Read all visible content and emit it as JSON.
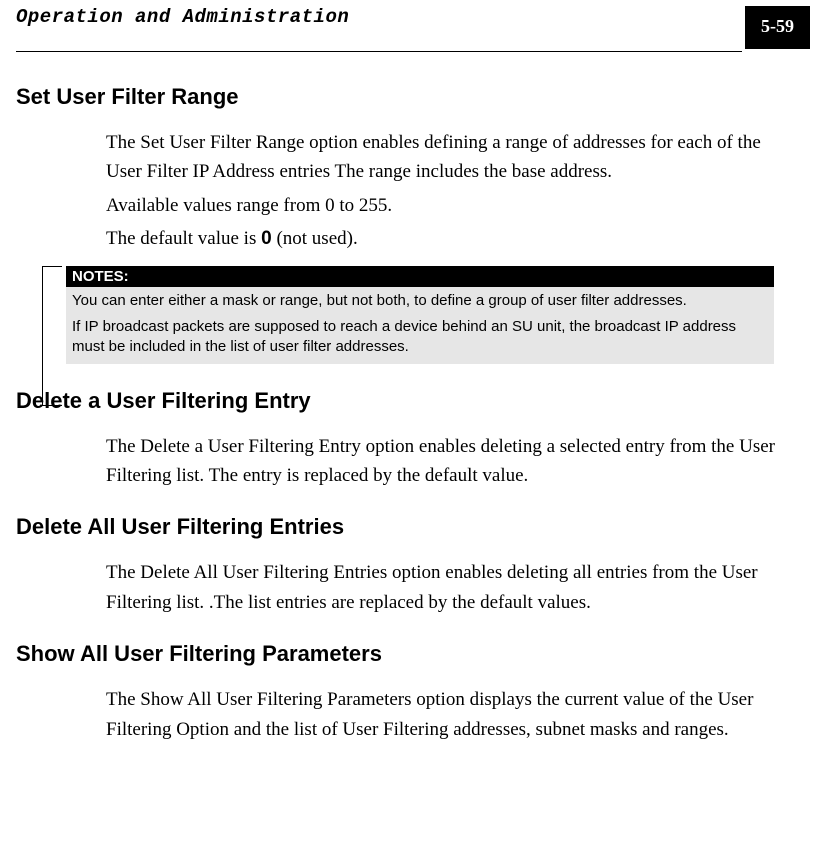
{
  "header": {
    "chapter_title": "Operation and Administration",
    "page_number": "5-59"
  },
  "sections": [
    {
      "heading": "Set User Filter Range",
      "paragraphs": [
        "The Set User Filter Range option enables defining a range of addresses for each of the User Filter IP Address entries The range  includes the base address.",
        "Available values range from 0 to 255."
      ],
      "default_prefix": "The default value is ",
      "default_bold": "0",
      "default_suffix": " (not used).",
      "notes_label": "NOTES:",
      "notes": [
        "You can enter either a mask or range, but not both, to define a group of user filter addresses.",
        "If IP broadcast packets are supposed to reach a device behind an SU unit, the broadcast IP address must be included in the list of user filter addresses."
      ]
    },
    {
      "heading": "Delete a User Filtering Entry",
      "paragraphs": [
        "The Delete a User Filtering Entry option enables deleting a selected entry from the User Filtering list. The entry is replaced by the default value."
      ]
    },
    {
      "heading": "Delete All User Filtering Entries",
      "paragraphs": [
        "The Delete All User Filtering Entries option enables deleting all entries from the User Filtering list. .The list entries are replaced by the default values."
      ]
    },
    {
      "heading": "Show All User Filtering Parameters",
      "paragraphs": [
        "The Show All User Filtering Parameters option displays the current value of the User Filtering Option and the list of User Filtering addresses, subnet masks and ranges."
      ]
    }
  ]
}
